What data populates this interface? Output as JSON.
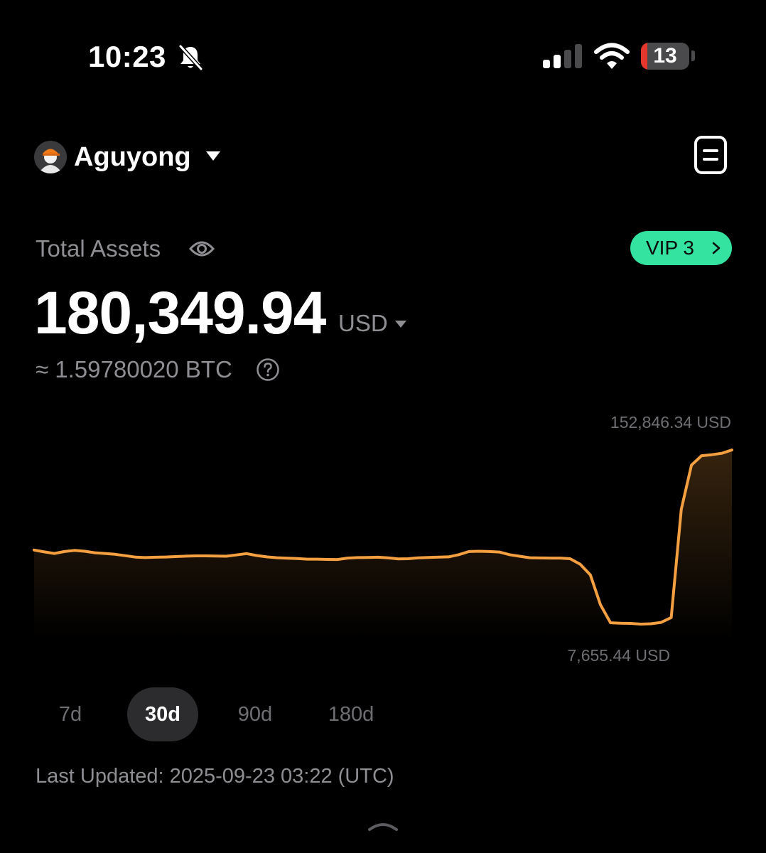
{
  "status_bar": {
    "time": "10:23",
    "battery_level": 13,
    "battery_label": "13",
    "signal_bars_active": 2,
    "signal_bars_total": 4,
    "icons": [
      "bell-slash-icon",
      "cellular-signal-icon",
      "wifi-icon",
      "battery-icon"
    ]
  },
  "header": {
    "account_name": "Aguyong",
    "icons": [
      "avatar-icon",
      "dropdown-caret-icon",
      "records-document-icon"
    ]
  },
  "assets": {
    "label": "Total Assets",
    "amount": "180,349.94",
    "currency": "USD",
    "btc_equivalent": "≈ 1.59780020 BTC",
    "vip_label": "VIP 3",
    "icons": [
      "eye-icon",
      "chevron-right-icon",
      "help-circle-icon",
      "currency-caret-icon"
    ]
  },
  "chart_data": {
    "type": "area",
    "max_label": "152,846.34 USD",
    "min_label": "7,655.44 USD",
    "y_min": 7655.44,
    "y_max": 152846.34,
    "values": [
      70400,
      68900,
      67600,
      69200,
      70100,
      69400,
      68200,
      67600,
      66900,
      65800,
      64600,
      64200,
      64500,
      64700,
      65000,
      65400,
      65600,
      65600,
      65500,
      65300,
      66400,
      67500,
      65900,
      64800,
      64100,
      63700,
      63400,
      62900,
      62900,
      62700,
      62600,
      63800,
      64200,
      64300,
      64500,
      64000,
      63100,
      63300,
      64000,
      64300,
      64600,
      64800,
      66600,
      69200,
      69400,
      69200,
      68800,
      66600,
      65300,
      64100,
      63900,
      63800,
      63800,
      63300,
      58700,
      50000,
      25400,
      10500,
      10100,
      10000,
      9400,
      9700,
      10800,
      14800,
      104000,
      140400,
      148100,
      148900,
      150100,
      152846.34
    ],
    "line_color": "#f5a040",
    "fill_color": "#f5a040",
    "grid": false
  },
  "periods": {
    "tabs": [
      "7d",
      "30d",
      "90d",
      "180d"
    ],
    "selected": "30d"
  },
  "footer": {
    "last_updated": "Last Updated: 2025-09-23 03:22 (UTC)",
    "icons": [
      "chevron-up-icon"
    ]
  }
}
